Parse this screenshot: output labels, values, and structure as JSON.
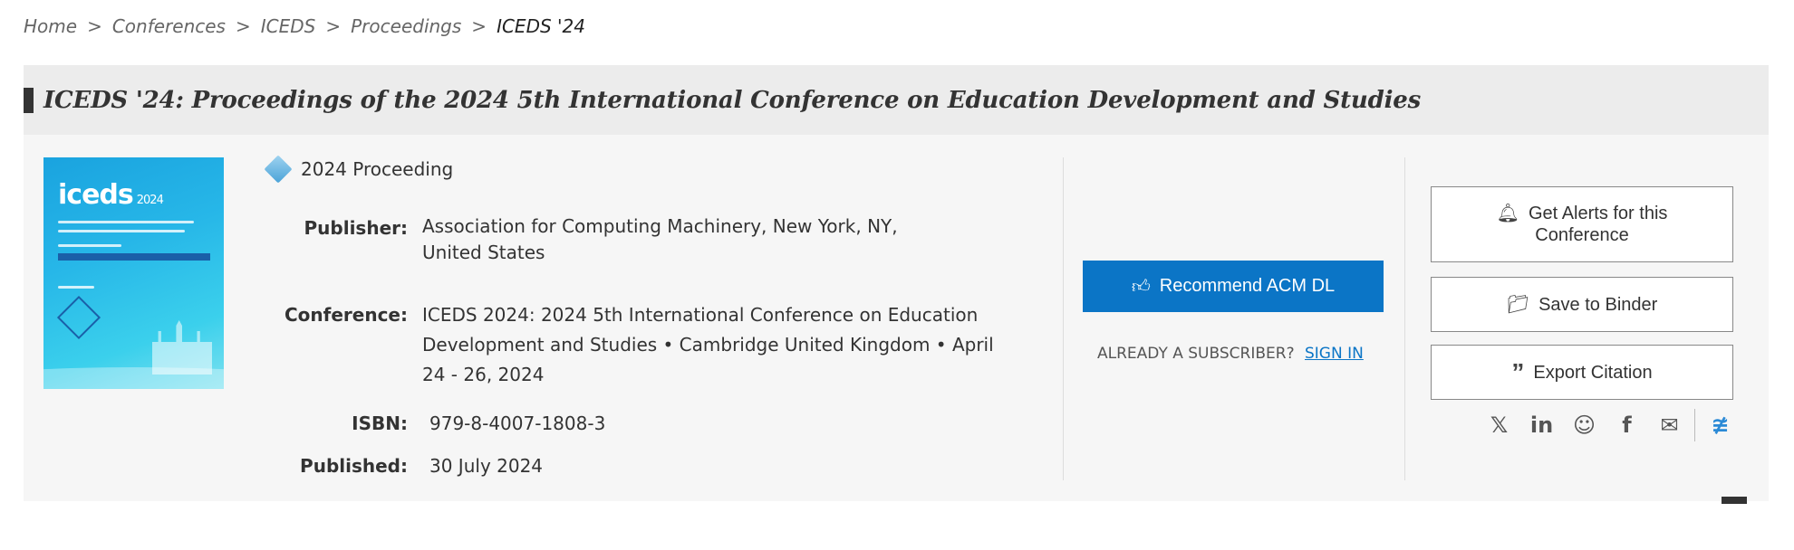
{
  "breadcrumb": {
    "items": [
      "Home",
      "Conferences",
      "ICEDS",
      "Proceedings"
    ],
    "current": "ICEDS '24",
    "separator": ">"
  },
  "page_title": "ICEDS '24: Proceedings of the 2024 5th International Conference on Education Development and Studies",
  "cover": {
    "logo_text": "iceds",
    "logo_year": "2024"
  },
  "proceeding": {
    "type_label": "2024 Proceeding",
    "publisher_label": "Publisher:",
    "publisher_line1": "Association for Computing Machinery, New York, NY,",
    "publisher_line2": "United States",
    "conference_label": "Conference:",
    "conference_line1": "ICEDS 2024: 2024 5th International Conference on Education",
    "conference_line2": "Development and Studies •  Cambridge United Kingdom  • April",
    "conference_line3": "24 - 26, 2024",
    "isbn_label": "ISBN:",
    "isbn_value": "979-8-4007-1808-3",
    "published_label": "Published:",
    "published_value": "30 July 2024"
  },
  "actions": {
    "recommend_label": "Recommend ACM DL",
    "subscriber_text": "ALREADY A SUBSCRIBER?",
    "sign_in_label": "SIGN IN",
    "alerts_line1": "Get Alerts for this",
    "alerts_line2": "Conference",
    "binder_label": "Save to Binder",
    "citation_label": "Export Citation"
  },
  "share_icons": [
    "x-icon",
    "linkedin-icon",
    "reddit-icon",
    "facebook-icon",
    "email-icon",
    "rss-icon"
  ],
  "colors": {
    "accent": "#0b75c6",
    "title_bg": "#ececec",
    "panel_bg": "#f6f6f6"
  }
}
